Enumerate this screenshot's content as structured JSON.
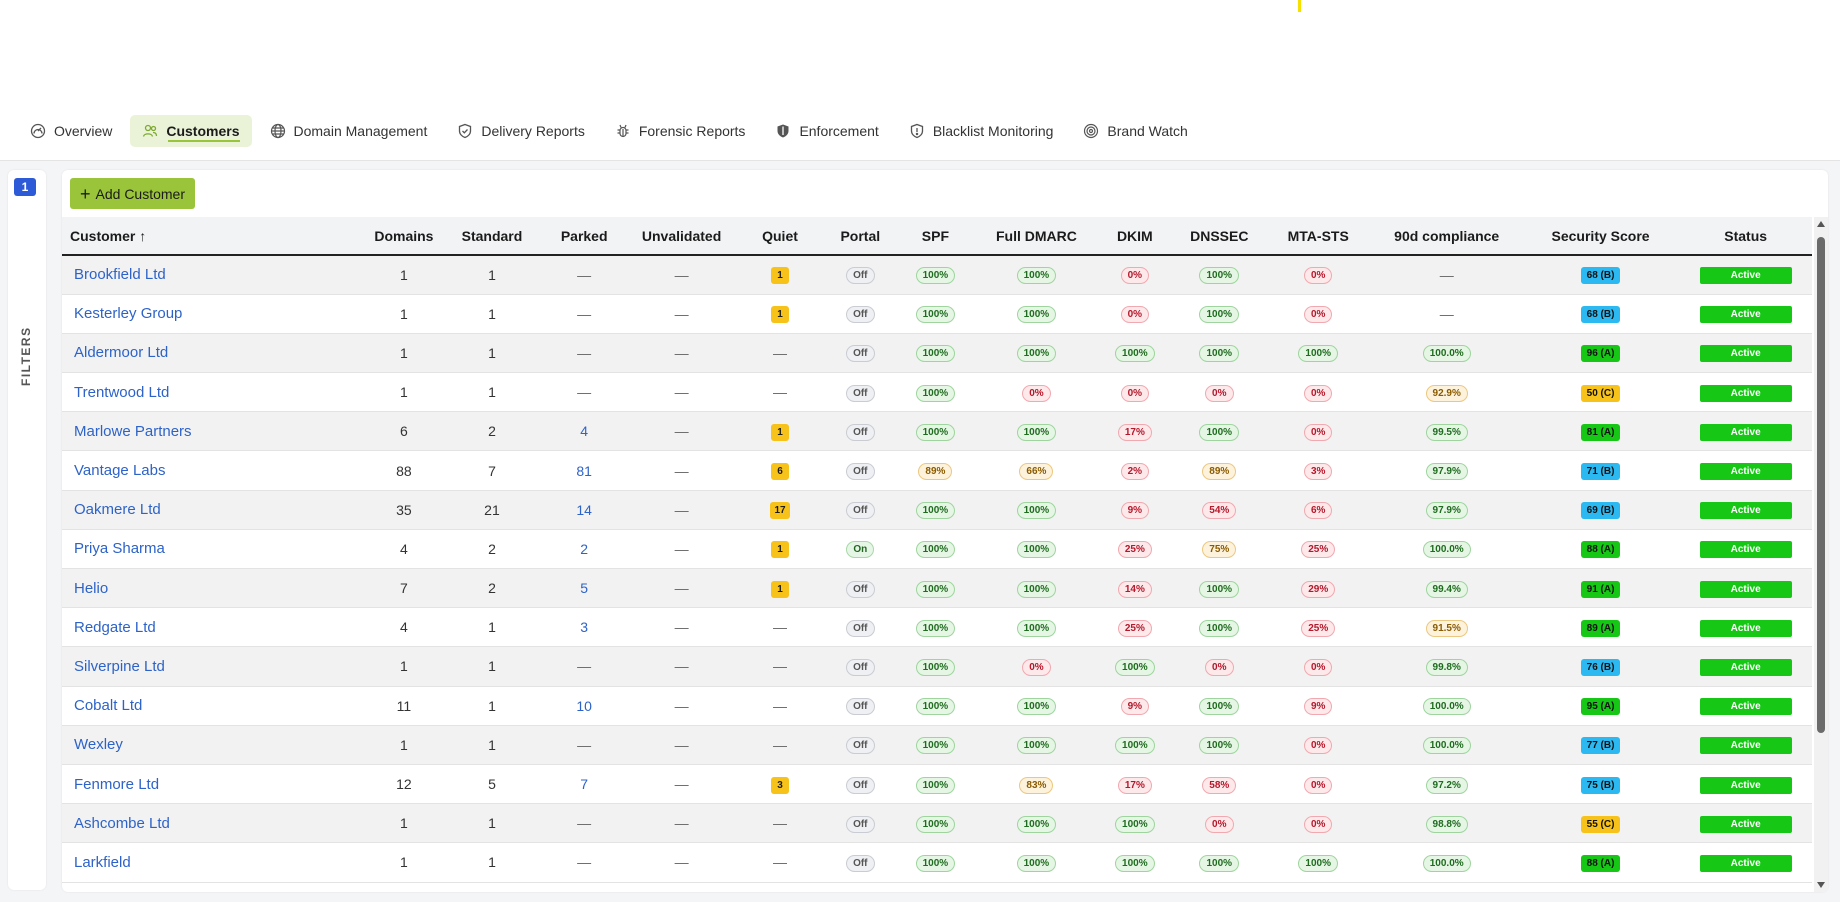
{
  "tabs": [
    {
      "label": "Overview",
      "icon": "gauge-icon",
      "active": false
    },
    {
      "label": "Customers",
      "icon": "users-icon",
      "active": true
    },
    {
      "label": "Domain Management",
      "icon": "globe-icon",
      "active": false
    },
    {
      "label": "Delivery Reports",
      "icon": "shield-check-icon",
      "active": false
    },
    {
      "label": "Forensic Reports",
      "icon": "bug-icon",
      "active": false
    },
    {
      "label": "Enforcement",
      "icon": "shield-half-icon",
      "active": false
    },
    {
      "label": "Blacklist Monitoring",
      "icon": "shield-alert-icon",
      "active": false
    },
    {
      "label": "Brand Watch",
      "icon": "target-icon",
      "active": false
    }
  ],
  "filters": {
    "count": "1",
    "label": "FILTERS"
  },
  "add_button": {
    "label": "Add Customer"
  },
  "columns": [
    "Customer ↑",
    "Domains",
    "Standard",
    "Parked",
    "Unvalidated",
    "Quiet",
    "Portal",
    "SPF",
    "Full DMARC",
    "DKIM",
    "DNSSEC",
    "MTA-STS",
    "90d compliance",
    "Security Score",
    "Status"
  ],
  "colors": {
    "accent": "#9ac53b",
    "link": "#2d63c8",
    "active_status": "#16c716",
    "score_a": "#16c716",
    "score_b": "#2cb8f0",
    "score_c": "#f7c21a"
  },
  "rows": [
    {
      "name": "Brookfield Ltd",
      "domains": "1",
      "standard": "1",
      "parked": "—",
      "unvalidated": "—",
      "quiet": "1",
      "portal": "Off",
      "spf": "100%",
      "full_dmarc": "100%",
      "dkim": "0%",
      "dnssec": "100%",
      "mta_sts": "0%",
      "compliance": "—",
      "score": "68 (B)",
      "status": "Active"
    },
    {
      "name": "Kesterley Group",
      "domains": "1",
      "standard": "1",
      "parked": "—",
      "unvalidated": "—",
      "quiet": "1",
      "portal": "Off",
      "spf": "100%",
      "full_dmarc": "100%",
      "dkim": "0%",
      "dnssec": "100%",
      "mta_sts": "0%",
      "compliance": "—",
      "score": "68 (B)",
      "status": "Active"
    },
    {
      "name": "Aldermoor Ltd",
      "domains": "1",
      "standard": "1",
      "parked": "—",
      "unvalidated": "—",
      "quiet": "—",
      "portal": "Off",
      "spf": "100%",
      "full_dmarc": "100%",
      "dkim": "100%",
      "dnssec": "100%",
      "mta_sts": "100%",
      "compliance": "100.0%",
      "score": "96 (A)",
      "status": "Active"
    },
    {
      "name": "Trentwood Ltd",
      "domains": "1",
      "standard": "1",
      "parked": "—",
      "unvalidated": "—",
      "quiet": "—",
      "portal": "Off",
      "spf": "100%",
      "full_dmarc": "0%",
      "dkim": "0%",
      "dnssec": "0%",
      "mta_sts": "0%",
      "compliance": "92.9%",
      "score": "50 (C)",
      "status": "Active"
    },
    {
      "name": "Marlowe Partners",
      "domains": "6",
      "standard": "2",
      "parked": "4",
      "unvalidated": "—",
      "quiet": "1",
      "portal": "Off",
      "spf": "100%",
      "full_dmarc": "100%",
      "dkim": "17%",
      "dnssec": "100%",
      "mta_sts": "0%",
      "compliance": "99.5%",
      "score": "81 (A)",
      "status": "Active"
    },
    {
      "name": "Vantage Labs",
      "domains": "88",
      "standard": "7",
      "parked": "81",
      "unvalidated": "—",
      "quiet": "6",
      "portal": "Off",
      "spf": "89%",
      "full_dmarc": "66%",
      "dkim": "2%",
      "dnssec": "89%",
      "mta_sts": "3%",
      "compliance": "97.9%",
      "score": "71 (B)",
      "status": "Active"
    },
    {
      "name": "Oakmere Ltd",
      "domains": "35",
      "standard": "21",
      "parked": "14",
      "unvalidated": "—",
      "quiet": "17",
      "portal": "Off",
      "spf": "100%",
      "full_dmarc": "100%",
      "dkim": "9%",
      "dnssec": "54%",
      "mta_sts": "6%",
      "compliance": "97.9%",
      "score": "69 (B)",
      "status": "Active"
    },
    {
      "name": "Priya Sharma",
      "domains": "4",
      "standard": "2",
      "parked": "2",
      "unvalidated": "—",
      "quiet": "1",
      "portal": "On",
      "spf": "100%",
      "full_dmarc": "100%",
      "dkim": "25%",
      "dnssec": "75%",
      "mta_sts": "25%",
      "compliance": "100.0%",
      "score": "88 (A)",
      "status": "Active"
    },
    {
      "name": "Helio",
      "domains": "7",
      "standard": "2",
      "parked": "5",
      "unvalidated": "—",
      "quiet": "1",
      "portal": "Off",
      "spf": "100%",
      "full_dmarc": "100%",
      "dkim": "14%",
      "dnssec": "100%",
      "mta_sts": "29%",
      "compliance": "99.4%",
      "score": "91 (A)",
      "status": "Active"
    },
    {
      "name": "Redgate Ltd",
      "domains": "4",
      "standard": "1",
      "parked": "3",
      "unvalidated": "—",
      "quiet": "—",
      "portal": "Off",
      "spf": "100%",
      "full_dmarc": "100%",
      "dkim": "25%",
      "dnssec": "100%",
      "mta_sts": "25%",
      "compliance": "91.5%",
      "score": "89 (A)",
      "status": "Active"
    },
    {
      "name": "Silverpine Ltd",
      "domains": "1",
      "standard": "1",
      "parked": "—",
      "unvalidated": "—",
      "quiet": "—",
      "portal": "Off",
      "spf": "100%",
      "full_dmarc": "0%",
      "dkim": "100%",
      "dnssec": "0%",
      "mta_sts": "0%",
      "compliance": "99.8%",
      "score": "76 (B)",
      "status": "Active"
    },
    {
      "name": "Cobalt Ltd",
      "domains": "11",
      "standard": "1",
      "parked": "10",
      "unvalidated": "—",
      "quiet": "—",
      "portal": "Off",
      "spf": "100%",
      "full_dmarc": "100%",
      "dkim": "9%",
      "dnssec": "100%",
      "mta_sts": "9%",
      "compliance": "100.0%",
      "score": "95 (A)",
      "status": "Active"
    },
    {
      "name": "Wexley",
      "domains": "1",
      "standard": "1",
      "parked": "—",
      "unvalidated": "—",
      "quiet": "—",
      "portal": "Off",
      "spf": "100%",
      "full_dmarc": "100%",
      "dkim": "100%",
      "dnssec": "100%",
      "mta_sts": "0%",
      "compliance": "100.0%",
      "score": "77 (B)",
      "status": "Active"
    },
    {
      "name": "Fenmore Ltd",
      "domains": "12",
      "standard": "5",
      "parked": "7",
      "unvalidated": "—",
      "quiet": "3",
      "portal": "Off",
      "spf": "100%",
      "full_dmarc": "83%",
      "dkim": "17%",
      "dnssec": "58%",
      "mta_sts": "0%",
      "compliance": "97.2%",
      "score": "75 (B)",
      "status": "Active"
    },
    {
      "name": "Ashcombe Ltd",
      "domains": "1",
      "standard": "1",
      "parked": "—",
      "unvalidated": "—",
      "quiet": "—",
      "portal": "Off",
      "spf": "100%",
      "full_dmarc": "100%",
      "dkim": "100%",
      "dnssec": "0%",
      "mta_sts": "0%",
      "compliance": "98.8%",
      "score": "55 (C)",
      "status": "Active"
    },
    {
      "name": "Larkfield",
      "domains": "1",
      "standard": "1",
      "parked": "—",
      "unvalidated": "—",
      "quiet": "—",
      "portal": "Off",
      "spf": "100%",
      "full_dmarc": "100%",
      "dkim": "100%",
      "dnssec": "100%",
      "mta_sts": "100%",
      "compliance": "100.0%",
      "score": "88 (A)",
      "status": "Active"
    }
  ]
}
